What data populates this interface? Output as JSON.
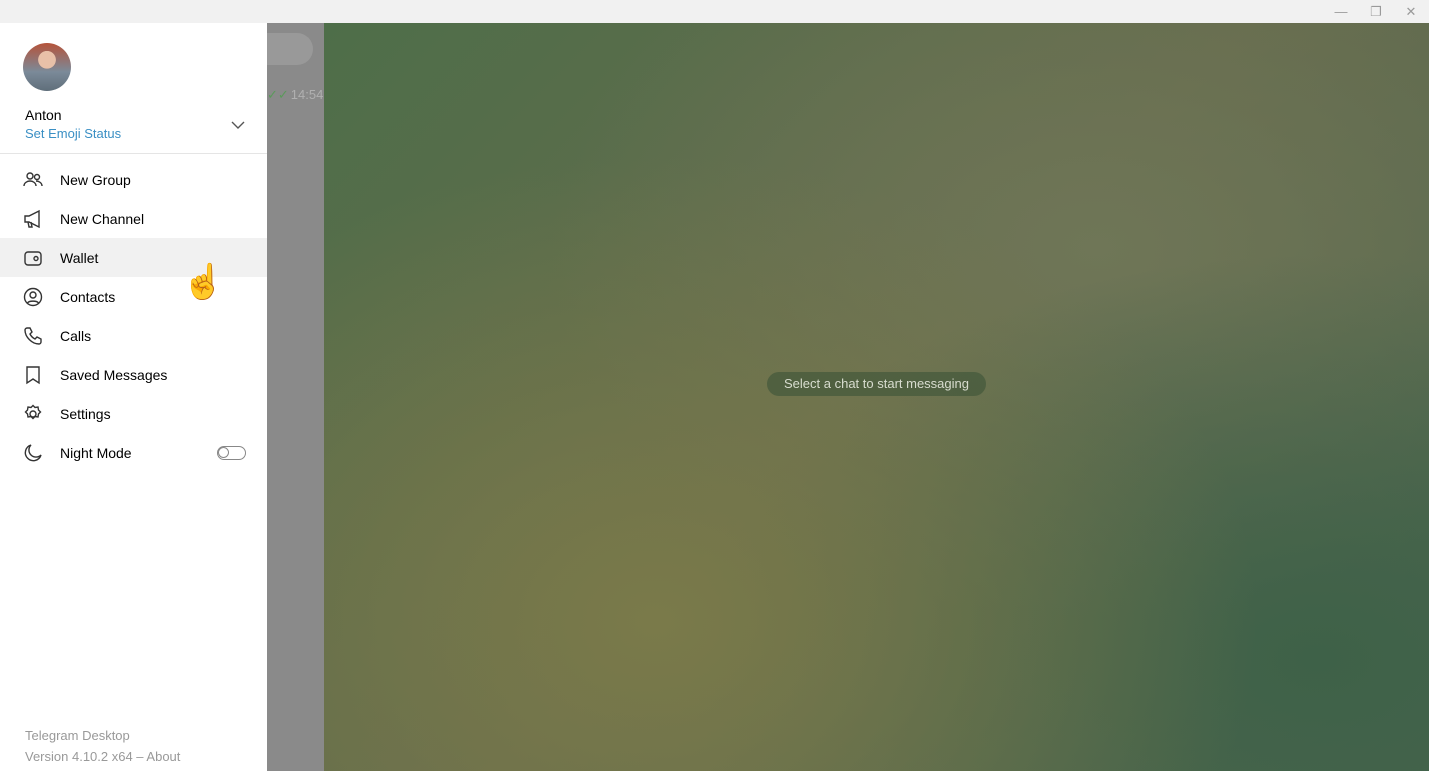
{
  "window": {
    "controls": [
      "minimize",
      "restore",
      "close"
    ]
  },
  "chat_list": {
    "last_time": "14:54"
  },
  "main": {
    "placeholder_hint": "Select a chat to start messaging"
  },
  "menu": {
    "user": {
      "name": "Anton",
      "status_link": "Set Emoji Status"
    },
    "items": [
      {
        "label": "New Group",
        "icon": "group-icon"
      },
      {
        "label": "New Channel",
        "icon": "megaphone-icon"
      },
      {
        "label": "Wallet",
        "icon": "wallet-icon"
      },
      {
        "label": "Contacts",
        "icon": "contact-icon"
      },
      {
        "label": "Calls",
        "icon": "phone-icon"
      },
      {
        "label": "Saved Messages",
        "icon": "bookmark-icon"
      },
      {
        "label": "Settings",
        "icon": "gear-icon"
      },
      {
        "label": "Night Mode",
        "icon": "moon-icon",
        "toggle": false
      }
    ],
    "footer": {
      "app": "Telegram Desktop",
      "version": "Version 4.10.2 x64 – About"
    }
  },
  "colors": {
    "accent": "#3a8fc4"
  }
}
